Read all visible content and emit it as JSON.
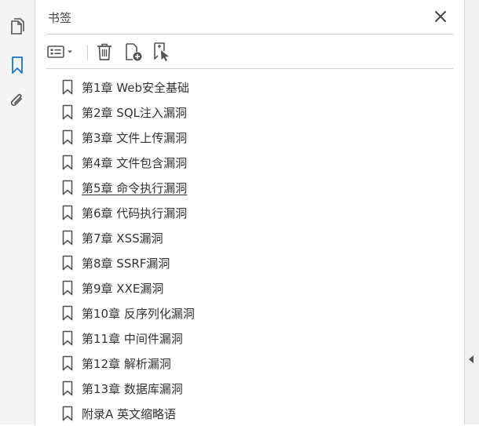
{
  "panel": {
    "title": "书签"
  },
  "left_rail": {
    "items": [
      {
        "icon": "pages-icon"
      },
      {
        "icon": "bookmark-icon",
        "active": true
      },
      {
        "icon": "attachment-icon"
      }
    ]
  },
  "toolbar": {
    "buttons": [
      {
        "icon": "options-menu-icon"
      },
      {
        "icon": "delete-icon"
      },
      {
        "icon": "new-bookmark-icon"
      },
      {
        "icon": "bookmark-from-selection-icon"
      }
    ]
  },
  "bookmarks": [
    {
      "label": "第1章 Web安全基础"
    },
    {
      "label": "第2章 SQL注入漏洞"
    },
    {
      "label": "第3章 文件上传漏洞"
    },
    {
      "label": "第4章 文件包含漏洞"
    },
    {
      "label": "第5章 命令执行漏洞",
      "hovered": true
    },
    {
      "label": "第6章 代码执行漏洞"
    },
    {
      "label": "第7章 XSS漏洞"
    },
    {
      "label": "第8章 SSRF漏洞"
    },
    {
      "label": "第9章 XXE漏洞"
    },
    {
      "label": "第10章 反序列化漏洞"
    },
    {
      "label": "第11章 中间件漏洞"
    },
    {
      "label": "第12章 解析漏洞"
    },
    {
      "label": "第13章 数据库漏洞"
    },
    {
      "label": "附录A 英文缩略语"
    }
  ],
  "colors": {
    "accent": "#1a73c7",
    "icon": "#555555"
  }
}
